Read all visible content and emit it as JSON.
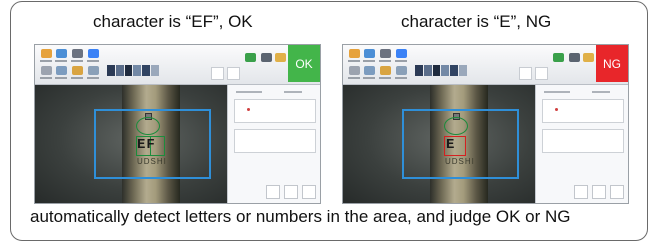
{
  "captions": {
    "left": "character is “EF”, OK",
    "right": "character is “E”, NG",
    "footer": "automatically detect  letters or numbers in the area, and judge OK or NG"
  },
  "screens": [
    {
      "verdict": "OK",
      "verdict_color": "#43b54a",
      "ocr_text": "EF",
      "box_color": "#1c8c3c"
    },
    {
      "verdict": "NG",
      "verdict_color": "#e8262a",
      "ocr_text": "E",
      "box_color": "#d42121"
    }
  ],
  "part_engraving": "UDSHI"
}
